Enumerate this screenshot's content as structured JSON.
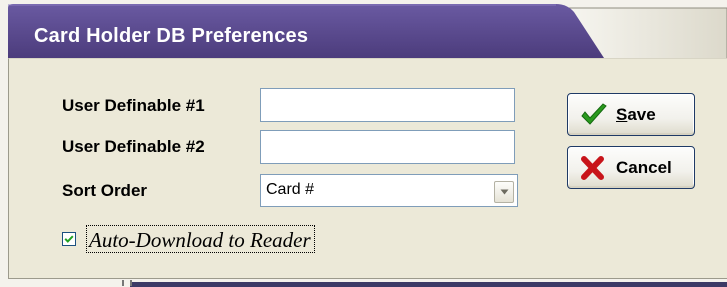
{
  "window": {
    "title": "Card Holder DB Preferences"
  },
  "form": {
    "user_definable_1_label": "User Definable #1",
    "user_definable_1_value": "",
    "user_definable_2_label": "User Definable #2",
    "user_definable_2_value": "",
    "sort_order_label": "Sort Order",
    "sort_order_value": "Card #",
    "auto_download_label": "Auto-Download to Reader",
    "auto_download_checked": true
  },
  "buttons": {
    "save": {
      "label": "Save",
      "accelerator": "S",
      "label_rest": "ave",
      "icon": "checkmark-icon"
    },
    "cancel": {
      "label": "Cancel",
      "icon": "x-mark-icon"
    }
  },
  "colors": {
    "title_bar": "#5a4a8c",
    "panel_background": "#ece9d8",
    "check_green": "#2a9a1e",
    "cancel_red": "#c8141a"
  }
}
